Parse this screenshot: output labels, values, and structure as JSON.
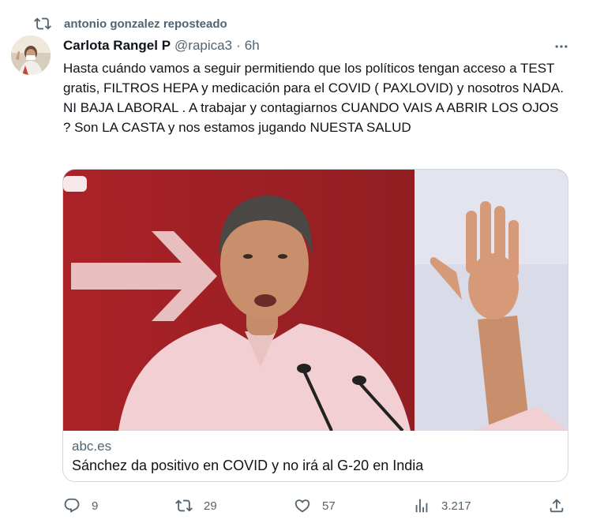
{
  "repost": {
    "text": "antonio gonzalez reposteado",
    "icon": "repost-icon"
  },
  "author": {
    "display_name": "Carlota Rangel P",
    "handle": "@rapica3",
    "separator": "·",
    "time": "6h"
  },
  "tweet": {
    "text": "Hasta cuándo vamos a seguir permitiendo que los políticos tengan acceso a TEST gratis, FILTROS HEPA y medicación para el COVID ( PAXLOVID) y nosotros NADA. NI BAJA LABORAL . A trabajar y contagiarnos CUANDO VAIS A ABRIR LOS OJOS ? Son LA CASTA y nos estamos jugando NUESTA SALUD"
  },
  "card": {
    "domain": "abc.es",
    "title": "Sánchez da positivo en COVID y no irá al G-20 en India"
  },
  "actions": {
    "replies": "9",
    "reposts": "29",
    "likes": "57",
    "views": "3.217"
  },
  "colors": {
    "text": "#0f1419",
    "muted": "#536471",
    "border": "#cfd9de",
    "card_red": "#b3242a"
  }
}
